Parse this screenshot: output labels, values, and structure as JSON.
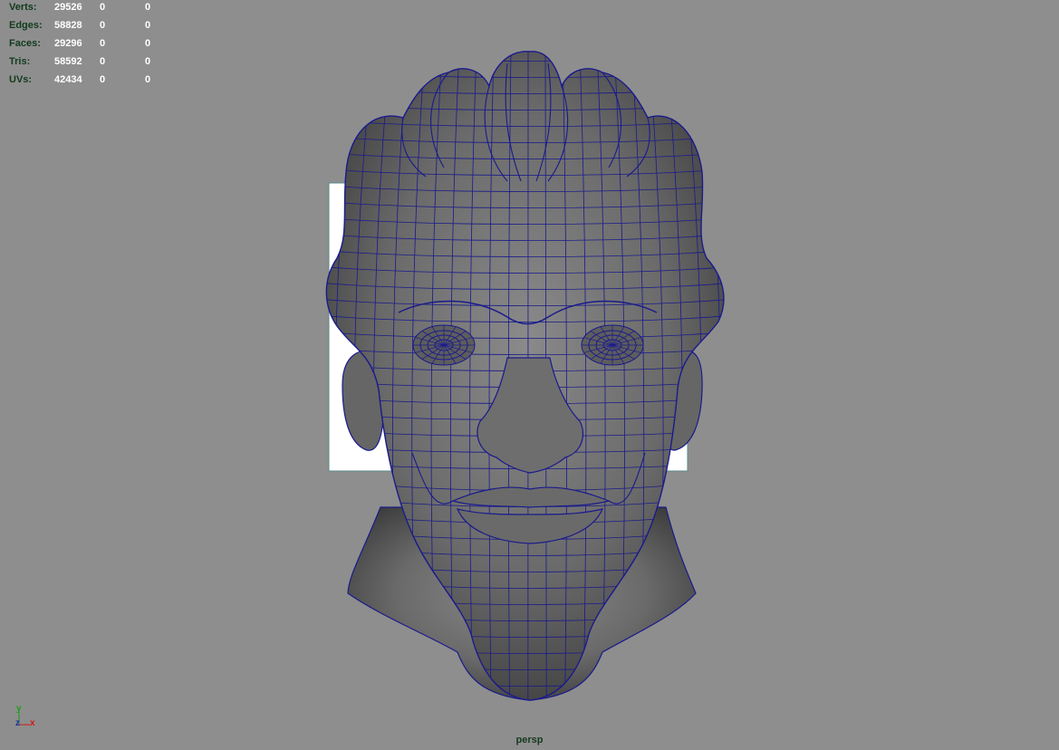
{
  "stats": {
    "rows": [
      {
        "label": "Verts:",
        "v1": "29526",
        "v2": "0",
        "v3": "0"
      },
      {
        "label": "Edges:",
        "v1": "58828",
        "v2": "0",
        "v3": "0"
      },
      {
        "label": "Faces:",
        "v1": "29296",
        "v2": "0",
        "v3": "0"
      },
      {
        "label": "Tris:",
        "v1": "58592",
        "v2": "0",
        "v3": "0"
      },
      {
        "label": "UVs:",
        "v1": "42434",
        "v2": "0",
        "v3": "0"
      }
    ]
  },
  "viewport": {
    "camera": "persp",
    "background_color": "#8e8e8e",
    "wireframe_color": "#1a1a8c"
  },
  "axis": {
    "y": "y",
    "z": "z",
    "x": "x"
  }
}
